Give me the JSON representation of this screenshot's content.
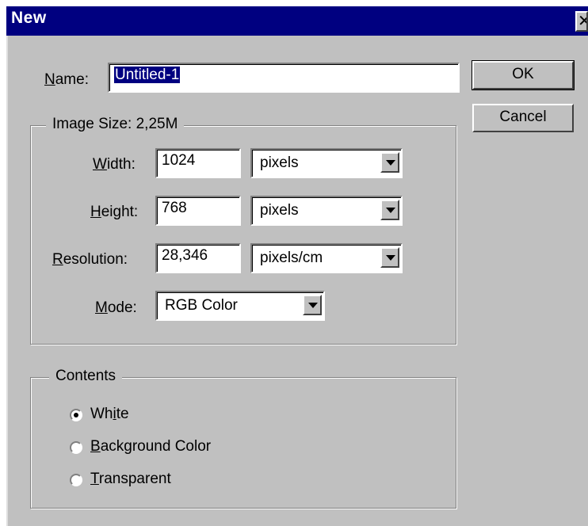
{
  "window": {
    "title": "New",
    "close_glyph": "✕"
  },
  "name": {
    "label_ul": "N",
    "label_rest": "ame:",
    "value": "Untitled-1"
  },
  "buttons": {
    "ok": "OK",
    "cancel": "Cancel"
  },
  "image_size": {
    "label": "Image Size:",
    "value": "2,25M",
    "width": {
      "label_ul": "W",
      "label_rest": "idth:",
      "value": "1024",
      "unit": "pixels"
    },
    "height": {
      "label_ul": "H",
      "label_rest": "eight:",
      "value": "768",
      "unit": "pixels"
    },
    "resolution": {
      "label_ul": "R",
      "label_rest": "esolution:",
      "value": "28,346",
      "unit": "pixels/cm"
    },
    "mode": {
      "label_ul": "M",
      "label_rest": "ode:",
      "value": "RGB Color"
    }
  },
  "contents": {
    "label": "Contents",
    "options": [
      {
        "pre": "Wh",
        "ul": "i",
        "post": "te",
        "checked": true
      },
      {
        "pre": "",
        "ul": "B",
        "post": "ackground Color",
        "checked": false
      },
      {
        "pre": "",
        "ul": "T",
        "post": "ransparent",
        "checked": false
      }
    ]
  },
  "colors": {
    "title_bar": "#000080",
    "face": "#c0c0c0",
    "selection": "#000080"
  },
  "icons": {
    "close": "close-icon",
    "dropdown": "chevron-down-icon",
    "radio": "radio-icon"
  }
}
